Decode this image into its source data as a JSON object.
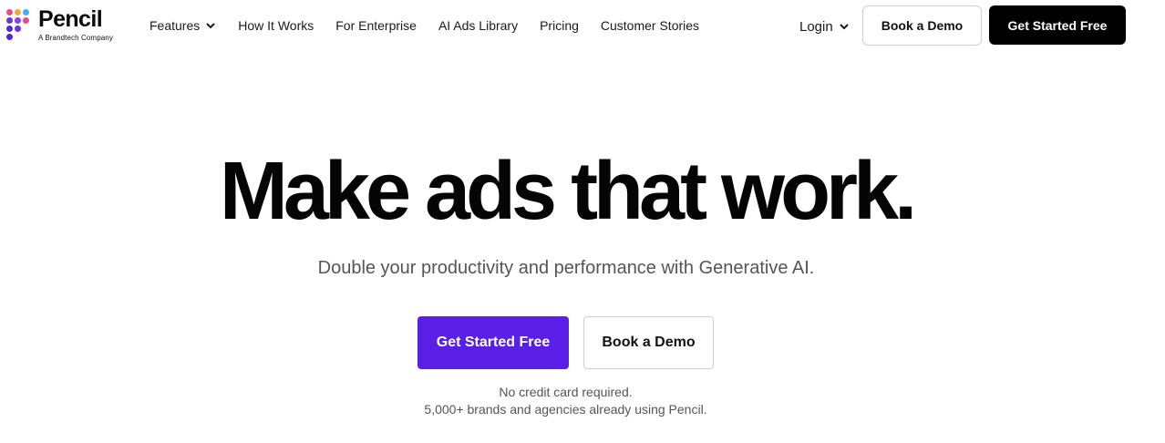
{
  "header": {
    "logo": {
      "name": "Pencil",
      "tagline": "A Brandtech Company",
      "dot_colors": [
        "#e94b8a",
        "#f2a93b",
        "#3ab5f0",
        "#6a35e0",
        "#8a43e8",
        "#4c2bd6"
      ]
    },
    "nav": [
      {
        "label": "Features",
        "has_dropdown": true
      },
      {
        "label": "How It Works",
        "has_dropdown": false
      },
      {
        "label": "For Enterprise",
        "has_dropdown": false
      },
      {
        "label": "AI Ads Library",
        "has_dropdown": false
      },
      {
        "label": "Pricing",
        "has_dropdown": false
      },
      {
        "label": "Customer Stories",
        "has_dropdown": false
      }
    ],
    "login_label": "Login",
    "book_demo_label": "Book a Demo",
    "get_started_label": "Get Started Free"
  },
  "hero": {
    "title": "Make ads that work.",
    "subtitle": "Double your productivity and performance with Generative AI.",
    "primary_cta": "Get Started Free",
    "secondary_cta": "Book a Demo",
    "note_line1": "No credit card required.",
    "note_line2": "5,000+ brands and agencies already using Pencil."
  },
  "colors": {
    "accent": "#5a1fe6",
    "dark_button": "#000000"
  }
}
